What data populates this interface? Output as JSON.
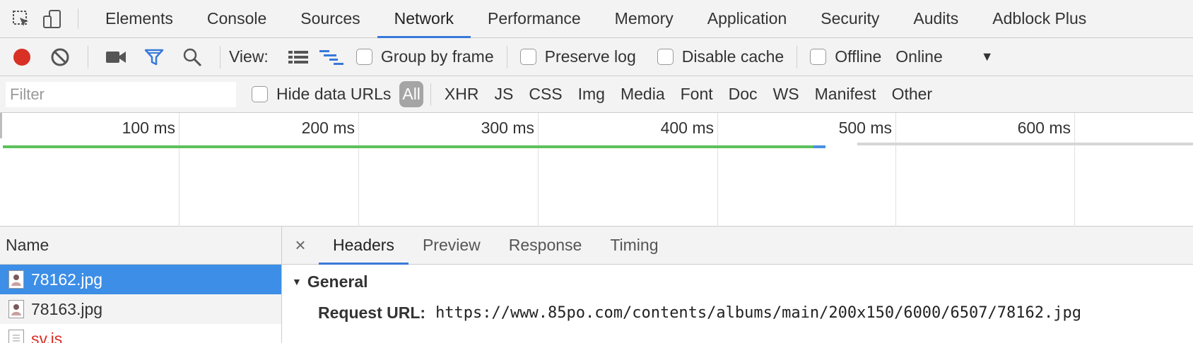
{
  "tabs": [
    "Elements",
    "Console",
    "Sources",
    "Network",
    "Performance",
    "Memory",
    "Application",
    "Security",
    "Audits",
    "Adblock Plus"
  ],
  "toolbar": {
    "view_label": "View:",
    "group_by_frame": "Group by frame",
    "preserve_log": "Preserve log",
    "disable_cache": "Disable cache",
    "offline": "Offline",
    "throttle_value": "Online"
  },
  "filter": {
    "placeholder": "Filter",
    "hide_data_urls": "Hide data URLs",
    "types": [
      "All",
      "XHR",
      "JS",
      "CSS",
      "Img",
      "Media",
      "Font",
      "Doc",
      "WS",
      "Manifest",
      "Other"
    ]
  },
  "timeline": {
    "ticks": [
      "100 ms",
      "200 ms",
      "300 ms",
      "400 ms",
      "500 ms",
      "600 ms"
    ]
  },
  "requests": {
    "header": "Name",
    "rows": [
      "78162.jpg",
      "78163.jpg",
      "sv.js"
    ]
  },
  "details": {
    "tabs": [
      "Headers",
      "Preview",
      "Response",
      "Timing"
    ],
    "section": "General",
    "request_url_key": "Request URL:",
    "request_url_value": "https://www.85po.com/contents/albums/main/200x150/6000/6507/78162.jpg"
  },
  "colors": {
    "accent": "#3879d9",
    "record": "#d93025",
    "selected_row": "#3d8ee6",
    "timeline_green": "#5cc15c",
    "timeline_blue": "#4a90e2"
  }
}
